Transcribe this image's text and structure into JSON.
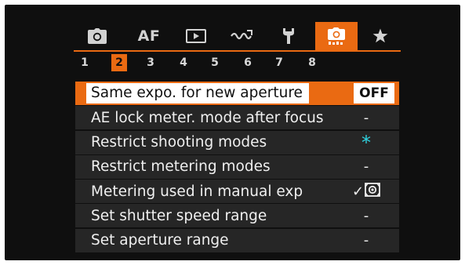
{
  "tabs": [
    {
      "id": "shooting",
      "icon": "camera-icon",
      "label": "",
      "active": false
    },
    {
      "id": "af",
      "icon": "",
      "label": "AF",
      "active": false
    },
    {
      "id": "playback",
      "icon": "playback-icon",
      "label": "",
      "active": false
    },
    {
      "id": "wireless",
      "icon": "wireless-icon",
      "label": "",
      "active": false
    },
    {
      "id": "setup",
      "icon": "wrench-icon",
      "label": "",
      "active": false
    },
    {
      "id": "custom",
      "icon": "custom-functions-camera-icon",
      "label": "",
      "active": true
    },
    {
      "id": "mymenu",
      "icon": "star-icon",
      "label": "",
      "active": false
    }
  ],
  "pages": [
    "1",
    "2",
    "3",
    "4",
    "5",
    "6",
    "7",
    "8"
  ],
  "active_page": "2",
  "menu_items": [
    {
      "label": "Same expo. for new aperture",
      "value": "OFF",
      "selected": true
    },
    {
      "label": "AE lock meter. mode after focus",
      "value": "-",
      "selected": false
    },
    {
      "label": "Restrict shooting modes",
      "value": "*",
      "selected": false
    },
    {
      "label": "Restrict metering modes",
      "value": "-",
      "selected": false
    },
    {
      "label": "Metering used in manual exp",
      "value": "✓",
      "value_icon": "evaluative-metering-icon",
      "selected": false
    },
    {
      "label": "Set shutter speed range",
      "value": "-",
      "selected": false
    },
    {
      "label": "Set aperture range",
      "value": "-",
      "selected": false
    }
  ],
  "colors": {
    "accent": "#ea6a12",
    "background": "#0f0f0f",
    "row": "#262626",
    "text": "#efefef",
    "cyan": "#2fd3e0"
  }
}
